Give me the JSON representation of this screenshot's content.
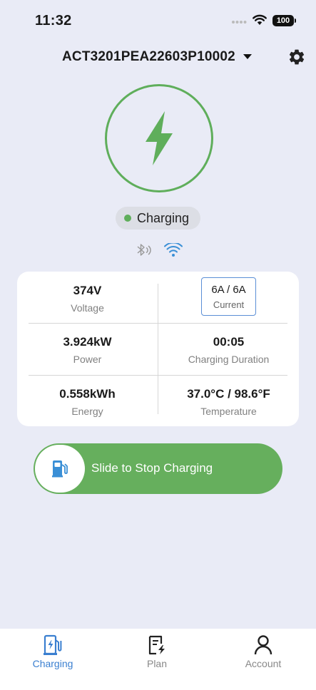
{
  "status_bar": {
    "time": "11:32",
    "battery": "100"
  },
  "device": {
    "name": "ACT3201PEA22603P10002"
  },
  "charge_status": {
    "label": "Charging"
  },
  "metrics": {
    "voltage": {
      "value": "374V",
      "label": "Voltage"
    },
    "current": {
      "value": "6A / 6A",
      "label": "Current"
    },
    "power": {
      "value": "3.924kW",
      "label": "Power"
    },
    "duration": {
      "value": "00:05",
      "label": "Charging Duration"
    },
    "energy": {
      "value": "0.558kWh",
      "label": "Energy"
    },
    "temperature": {
      "value": "37.0°C / 98.6°F",
      "label": "Temperature"
    }
  },
  "slider": {
    "label": "Slide to Stop Charging"
  },
  "tabs": [
    {
      "label": "Charging",
      "icon": "charger-icon",
      "active": true
    },
    {
      "label": "Plan",
      "icon": "plan-icon",
      "active": false
    },
    {
      "label": "Account",
      "icon": "account-icon",
      "active": false
    }
  ],
  "colors": {
    "accent_green": "#5fae5b",
    "active_tab": "#3a7fd0",
    "background": "#e9ebf6"
  },
  "icons": [
    "signal-icon",
    "wifi-icon",
    "battery-icon",
    "dropdown-caret-icon",
    "gear-icon",
    "lightning-bolt-icon",
    "bluetooth-icon",
    "wifi-connection-icon",
    "fuel-pump-icon"
  ]
}
